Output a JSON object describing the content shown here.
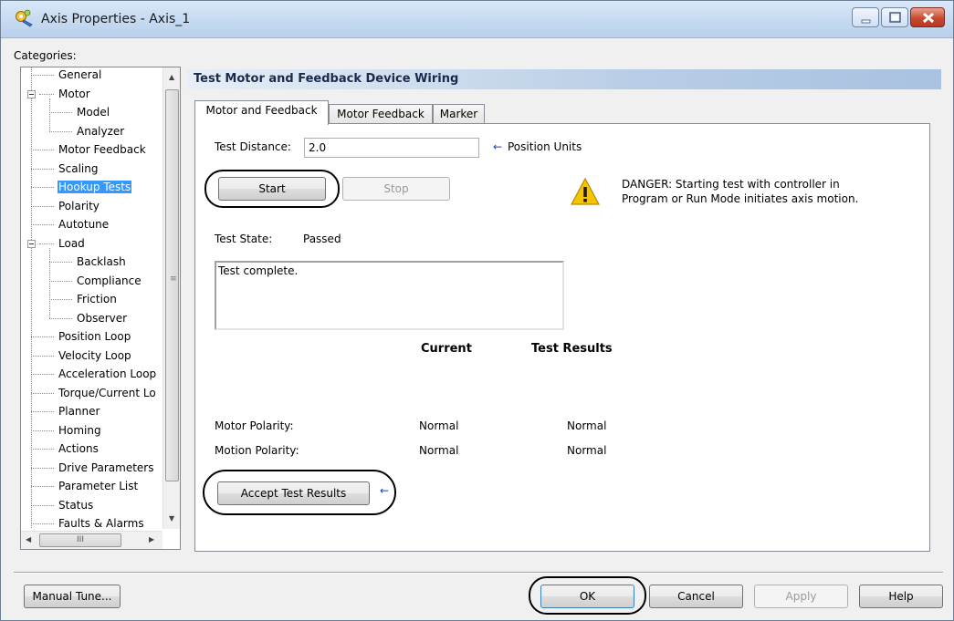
{
  "window": {
    "title": "Axis Properties - Axis_1",
    "icon": "axis-gear-icon"
  },
  "categories": {
    "label": "Categories:",
    "items": [
      {
        "label": "General",
        "level": 0
      },
      {
        "label": "Motor",
        "level": 0,
        "expanded": true
      },
      {
        "label": "Model",
        "level": 1
      },
      {
        "label": "Analyzer",
        "level": 1
      },
      {
        "label": "Motor Feedback",
        "level": 0
      },
      {
        "label": "Scaling",
        "level": 0
      },
      {
        "label": "Hookup Tests",
        "level": 0,
        "selected": true
      },
      {
        "label": "Polarity",
        "level": 0
      },
      {
        "label": "Autotune",
        "level": 0
      },
      {
        "label": "Load",
        "level": 0,
        "expanded": true
      },
      {
        "label": "Backlash",
        "level": 1
      },
      {
        "label": "Compliance",
        "level": 1
      },
      {
        "label": "Friction",
        "level": 1
      },
      {
        "label": "Observer",
        "level": 1
      },
      {
        "label": "Position Loop",
        "level": 0
      },
      {
        "label": "Velocity Loop",
        "level": 0
      },
      {
        "label": "Acceleration Loop",
        "level": 0
      },
      {
        "label": "Torque/Current Lo",
        "level": 0
      },
      {
        "label": "Planner",
        "level": 0
      },
      {
        "label": "Homing",
        "level": 0
      },
      {
        "label": "Actions",
        "level": 0
      },
      {
        "label": "Drive Parameters",
        "level": 0
      },
      {
        "label": "Parameter List",
        "level": 0
      },
      {
        "label": "Status",
        "level": 0
      },
      {
        "label": "Faults & Alarms",
        "level": 0
      }
    ],
    "hscroll_thumb_glyph": "III"
  },
  "section": {
    "title": "Test Motor and Feedback Device Wiring"
  },
  "tabs": [
    {
      "label": "Motor and Feedback",
      "active": true
    },
    {
      "label": "Motor Feedback",
      "active": false
    },
    {
      "label": "Marker",
      "active": false
    }
  ],
  "test": {
    "distance_label": "Test Distance:",
    "distance_value": "2.0",
    "distance_units": "Position Units",
    "start_label": "Start",
    "stop_label": "Stop",
    "danger_text_line1": "DANGER: Starting test with controller in",
    "danger_text_line2": "Program or Run Mode initiates axis motion.",
    "state_label": "Test State:",
    "state_value": "Passed",
    "message": "Test complete.",
    "col_current": "Current",
    "col_results": "Test Results",
    "rows": [
      {
        "label": "Motor Polarity:",
        "current": "Normal",
        "result": "Normal"
      },
      {
        "label": "Motion Polarity:",
        "current": "Normal",
        "result": "Normal"
      }
    ],
    "accept_label": "Accept Test Results"
  },
  "footer": {
    "manual_tune_label": "Manual Tune...",
    "ok_label": "OK",
    "cancel_label": "Cancel",
    "apply_label": "Apply",
    "help_label": "Help"
  },
  "colors": {
    "selection": "#3399ff",
    "header_gradient_end": "#a9c2e1",
    "arrow_blue": "#2040c0",
    "warning_yellow": "#f5c400"
  }
}
